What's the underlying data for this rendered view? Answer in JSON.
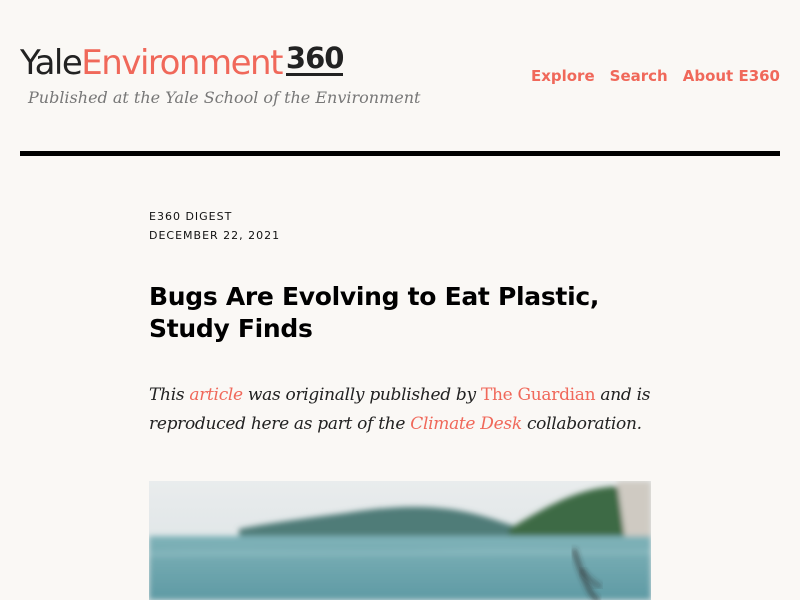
{
  "site": {
    "logo_part1": "Yale",
    "logo_part2": "Environment",
    "logo_part3": "360",
    "tagline": "Published at the Yale School of the Environment"
  },
  "nav": {
    "items": [
      "Explore",
      "Search",
      "About E360"
    ]
  },
  "article": {
    "section": "E360 Digest",
    "date": "December 22, 2021",
    "title": "Bugs Are Evolving to Eat Plastic, Study Finds",
    "intro": {
      "t1": "This",
      "link1": "article",
      "t2": "was originally published by",
      "link2": "The Guardian",
      "t3": "and is reproduced here as part of the",
      "link3": "Climate Desk",
      "t4": "collaboration."
    }
  },
  "colors": {
    "accent": "#f0685a",
    "background": "#faf8f5",
    "text": "#111111"
  }
}
